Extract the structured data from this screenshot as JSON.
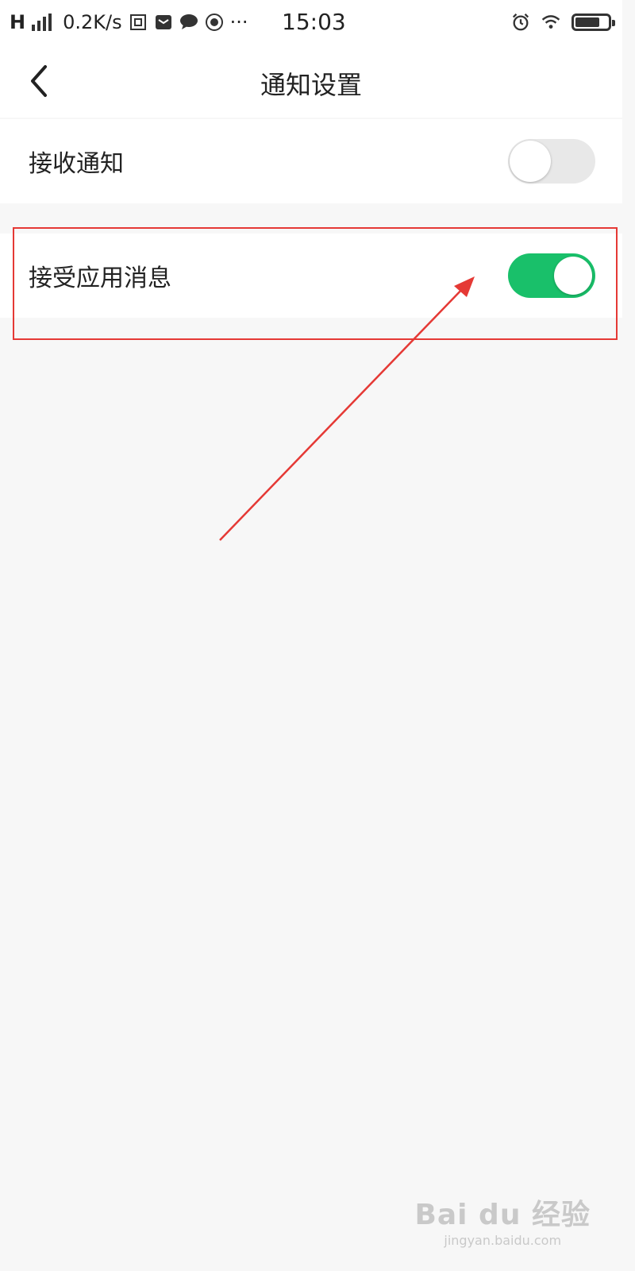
{
  "status_bar": {
    "network_type": "H",
    "data_rate": "0.2K/s",
    "more": "···",
    "time": "15:03",
    "icons": [
      "signal-icon",
      "notification-icon",
      "mail-icon",
      "chat-icon",
      "app-icon",
      "alarm-icon",
      "wifi-icon",
      "battery-icon"
    ],
    "battery_level": 0.75
  },
  "navbar": {
    "title": "通知设置",
    "back_icon": "chevron-left-icon"
  },
  "settings": [
    {
      "label": "接收通知",
      "enabled": false
    },
    {
      "label": "接受应用消息",
      "enabled": true
    }
  ],
  "colors": {
    "toggle_on": "#19c06a",
    "toggle_off": "#e8e8e8",
    "annotation": "#e53935",
    "background": "#f7f7f7"
  },
  "watermark": {
    "main": "Bai du 经验",
    "sub": "jingyan.baidu.com"
  }
}
